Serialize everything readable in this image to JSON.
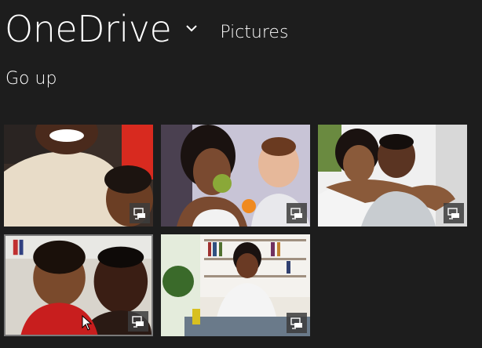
{
  "header": {
    "app_title": "OneDrive",
    "breadcrumb": "Pictures"
  },
  "nav": {
    "go_up_label": "Go up"
  },
  "photos": [
    {
      "id": "photo-1",
      "selected": false
    },
    {
      "id": "photo-2",
      "selected": false
    },
    {
      "id": "photo-3",
      "selected": false
    },
    {
      "id": "photo-4",
      "selected": true
    },
    {
      "id": "photo-5",
      "selected": false
    }
  ],
  "icons": {
    "dropdown": "chevron-down-icon",
    "photo_badge": "cloud-offline-icon"
  },
  "colors": {
    "background": "#1d1d1d",
    "text": "#ffffff",
    "selection_border": "#7a7a7a"
  }
}
